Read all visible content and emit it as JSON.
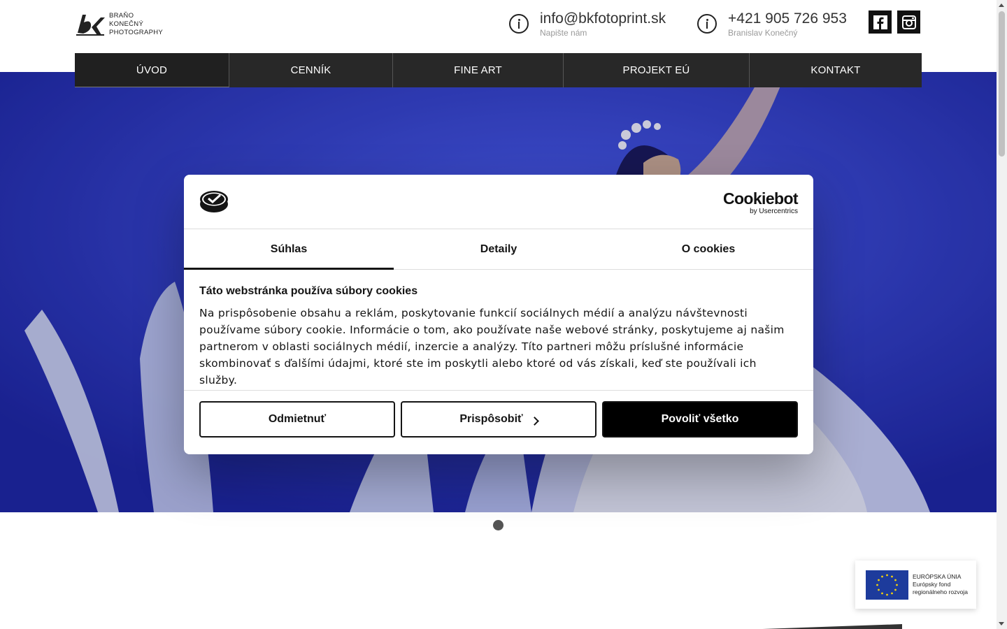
{
  "logo": {
    "lines": [
      "BRAŇO",
      "KONEČNÝ",
      "PHOTOGRAPHY"
    ]
  },
  "contact": {
    "email": {
      "main": "info@bkfotoprint.sk",
      "sub": "Napište nám"
    },
    "phone": {
      "main": "+421 905 726 953",
      "sub": "Branislav Konečný"
    }
  },
  "social": [
    "facebook-icon",
    "instagram-icon"
  ],
  "nav": [
    {
      "label": "ÚVOD",
      "active": true
    },
    {
      "label": "CENNÍK",
      "active": false
    },
    {
      "label": "FINE ART",
      "active": false
    },
    {
      "label": "PROJEKT EÚ",
      "active": false
    },
    {
      "label": "KONTAKT",
      "active": false
    }
  ],
  "cookie": {
    "brand": "Cookiebot",
    "brand_sub": "by Usercentrics",
    "tabs": [
      "Súhlas",
      "Detaily",
      "O cookies"
    ],
    "title": "Táto webstránka používa súbory cookies",
    "text": "Na prispôsobenie obsahu a reklám, poskytovanie funkcií sociálnych médií a analýzu návštevnosti používame súbory cookie. Informácie o tom, ako používate naše webové stránky, poskytujeme aj našim partnerom v oblasti sociálnych médií, inzercie a analýzy. Títo partneri môžu príslušné informácie skombinovať s ďalšími údajmi, ktoré ste im poskytli alebo ktoré od vás získali, keď ste používali ich služby.",
    "buttons": {
      "reject": "Odmietnuť",
      "customize": "Prispôsobiť",
      "allow": "Povoliť všetko"
    }
  },
  "eu_badge": {
    "lines": [
      "EURÓPSKA ÚNIA",
      "Európsky fond",
      "regionálneho rozvoja"
    ]
  },
  "colors": {
    "nav_bg": "#282828",
    "hero_blue": "#2834c8",
    "eu_blue": "#1d3b9c",
    "eu_star": "#f5d20a"
  }
}
